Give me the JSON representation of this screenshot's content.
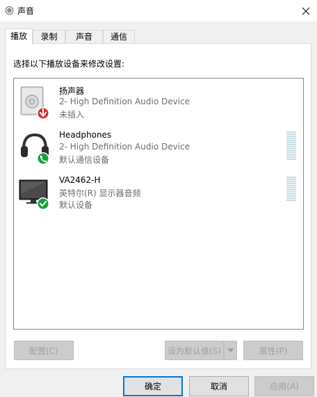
{
  "window": {
    "title": "声音",
    "close_icon": "close-icon",
    "app_icon": "speaker-icon"
  },
  "tabs": [
    {
      "label": "播放",
      "active": true
    },
    {
      "label": "录制",
      "active": false
    },
    {
      "label": "声音",
      "active": false
    },
    {
      "label": "通信",
      "active": false
    }
  ],
  "panel": {
    "instruction": "选择以下播放设备来修改设置:"
  },
  "devices": [
    {
      "name": "扬声器",
      "description": "2- High Definition Audio Device",
      "status": "未插入",
      "icon": "speaker-icon",
      "badge": "unplugged-arrow-icon",
      "badge_color": "#d9302c",
      "show_meter": false
    },
    {
      "name": "Headphones",
      "description": "2- High Definition Audio Device",
      "status": "默认通信设备",
      "icon": "headphones-icon",
      "badge": "phone-icon",
      "badge_color": "#1b9e3e",
      "show_meter": true
    },
    {
      "name": "VA2462-H",
      "description": "英特尔(R) 显示器音频",
      "status": "默认设备",
      "icon": "monitor-icon",
      "badge": "checkmark-icon",
      "badge_color": "#1b9e3e",
      "show_meter": true
    }
  ],
  "panel_buttons": {
    "configure": "配置(C)",
    "set_default": "设为默认值(S)",
    "properties": "属性(P)"
  },
  "dialog_buttons": {
    "ok": "确定",
    "cancel": "取消",
    "apply": "应用(A)"
  }
}
